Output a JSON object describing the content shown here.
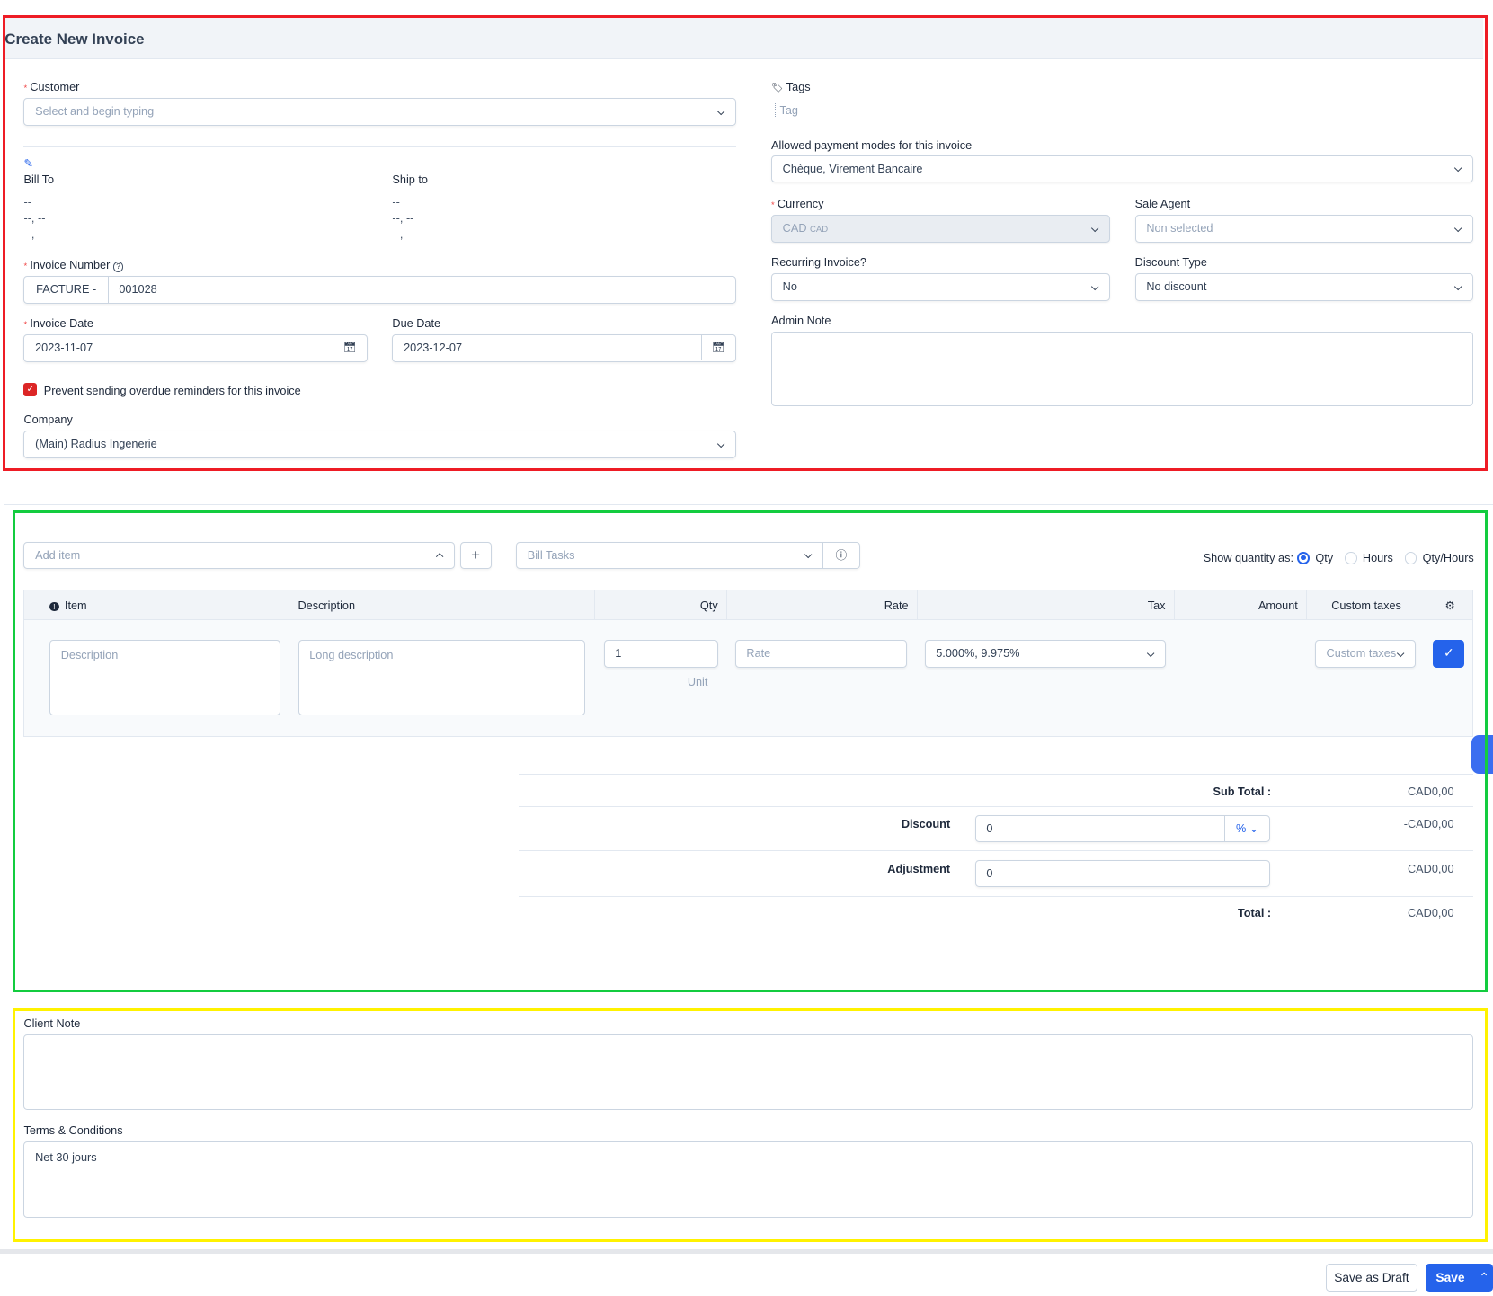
{
  "header": {
    "title": "Create New Invoice"
  },
  "customer": {
    "label": "Customer",
    "placeholder": "Select and begin typing"
  },
  "bill_to": {
    "label": "Bill To",
    "lines": [
      "--",
      "--, --",
      "--, --"
    ]
  },
  "ship_to": {
    "label": "Ship to",
    "lines": [
      "--",
      "--, --",
      "--, --"
    ]
  },
  "invoice_number": {
    "label": "Invoice Number",
    "prefix": "FACTURE -",
    "value": "001028"
  },
  "invoice_date": {
    "label": "Invoice Date",
    "value": "2023-11-07"
  },
  "due_date": {
    "label": "Due Date",
    "value": "2023-12-07"
  },
  "prevent_reminders": {
    "label": "Prevent sending overdue reminders for this invoice",
    "checked": true
  },
  "company": {
    "label": "Company",
    "value": "(Main) Radius Ingenerie"
  },
  "tags": {
    "label": "Tags",
    "placeholder": "Tag"
  },
  "payment_modes": {
    "label": "Allowed payment modes for this invoice",
    "value": "Chèque, Virement Bancaire"
  },
  "currency": {
    "label": "Currency",
    "value": "CAD",
    "suffix": "CAD"
  },
  "sale_agent": {
    "label": "Sale Agent",
    "value": "Non selected"
  },
  "recurring": {
    "label": "Recurring Invoice?",
    "value": "No"
  },
  "discount_type": {
    "label": "Discount Type",
    "value": "No discount"
  },
  "admin_note": {
    "label": "Admin Note",
    "value": ""
  },
  "items": {
    "add_item_placeholder": "Add item",
    "bill_tasks_placeholder": "Bill Tasks",
    "show_quantity_label": "Show quantity as:",
    "quantity_options": [
      "Qty",
      "Hours",
      "Qty/Hours"
    ],
    "quantity_selected": "Qty",
    "columns": [
      "Item",
      "Description",
      "Qty",
      "Rate",
      "Tax",
      "Amount",
      "Custom taxes"
    ],
    "row": {
      "description_placeholder": "Description",
      "long_description_placeholder": "Long description",
      "qty": "1",
      "unit_placeholder": "Unit",
      "rate_placeholder": "Rate",
      "tax": "5.000%, 9.975%",
      "custom_taxes_placeholder": "Custom taxes"
    }
  },
  "totals": {
    "subtotal_label": "Sub Total :",
    "subtotal": "CAD0,00",
    "discount_label": "Discount",
    "discount_value": "0",
    "discount_unit": "%",
    "discount": "-CAD0,00",
    "adjustment_label": "Adjustment",
    "adjustment_value": "0",
    "adjustment": "CAD0,00",
    "total_label": "Total :",
    "total": "CAD0,00"
  },
  "client_note": {
    "label": "Client Note",
    "value": ""
  },
  "terms": {
    "label": "Terms & Conditions",
    "value": "Net 30 jours"
  },
  "footer": {
    "save_draft": "Save as Draft",
    "save": "Save"
  },
  "colors": {
    "primary": "#2563eb",
    "annotation_red": "#ee1c25",
    "annotation_green": "#13cc3f",
    "annotation_yellow": "#fff200"
  }
}
